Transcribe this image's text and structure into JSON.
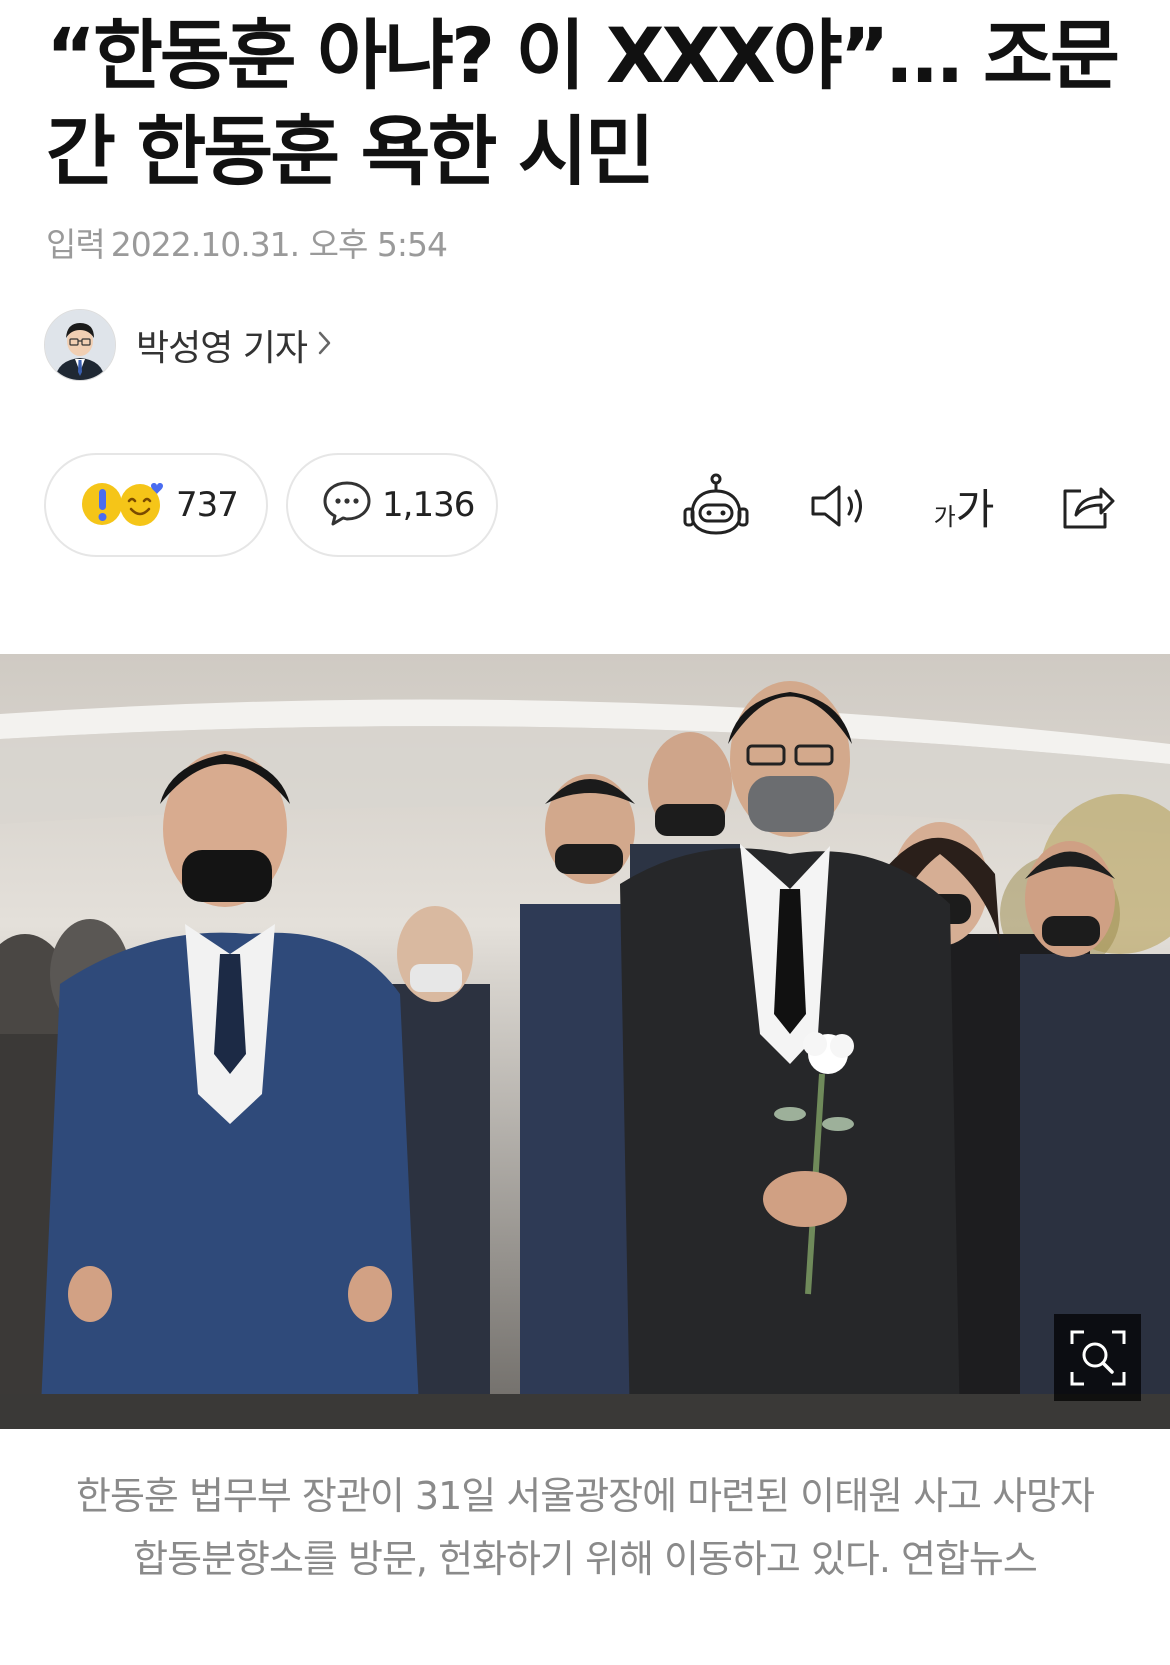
{
  "article": {
    "title": "“한동훈 아냐? 이 XXX야”… 조문간 한동훈 욕한 시민",
    "meta_label": "입력",
    "meta_datetime": "2022.10.31. 오후 5:54"
  },
  "author": {
    "name": "박성영 기자",
    "avatar_icon": "reporter-avatar"
  },
  "reactions": {
    "count": "737",
    "icons": [
      "surprised-emoji-icon",
      "smile-heart-emoji-icon"
    ]
  },
  "comments": {
    "count": "1,136",
    "icon": "speech-bubble-icon"
  },
  "toolbar": {
    "icons": [
      "robot-summary-icon",
      "speaker-icon",
      "font-size-icon",
      "share-icon"
    ],
    "font_size_small": "가",
    "font_size_large": "가"
  },
  "photo": {
    "zoom_icon": "zoom-search-icon",
    "caption": "한동훈 법무부 장관이 31일 서울광장에 마련된 이태원 사고 사망자 합동분향소를 방문, 헌화하기 위해 이동하고 있다. 연합뉴스"
  },
  "colors": {
    "title": "#111111",
    "meta": "#9a9a9a",
    "caption": "#8a8a8a",
    "pill_border": "#e6e6e6",
    "surprised_emoji": "#f5c518",
    "exclaim_blue": "#4a6cf0"
  }
}
